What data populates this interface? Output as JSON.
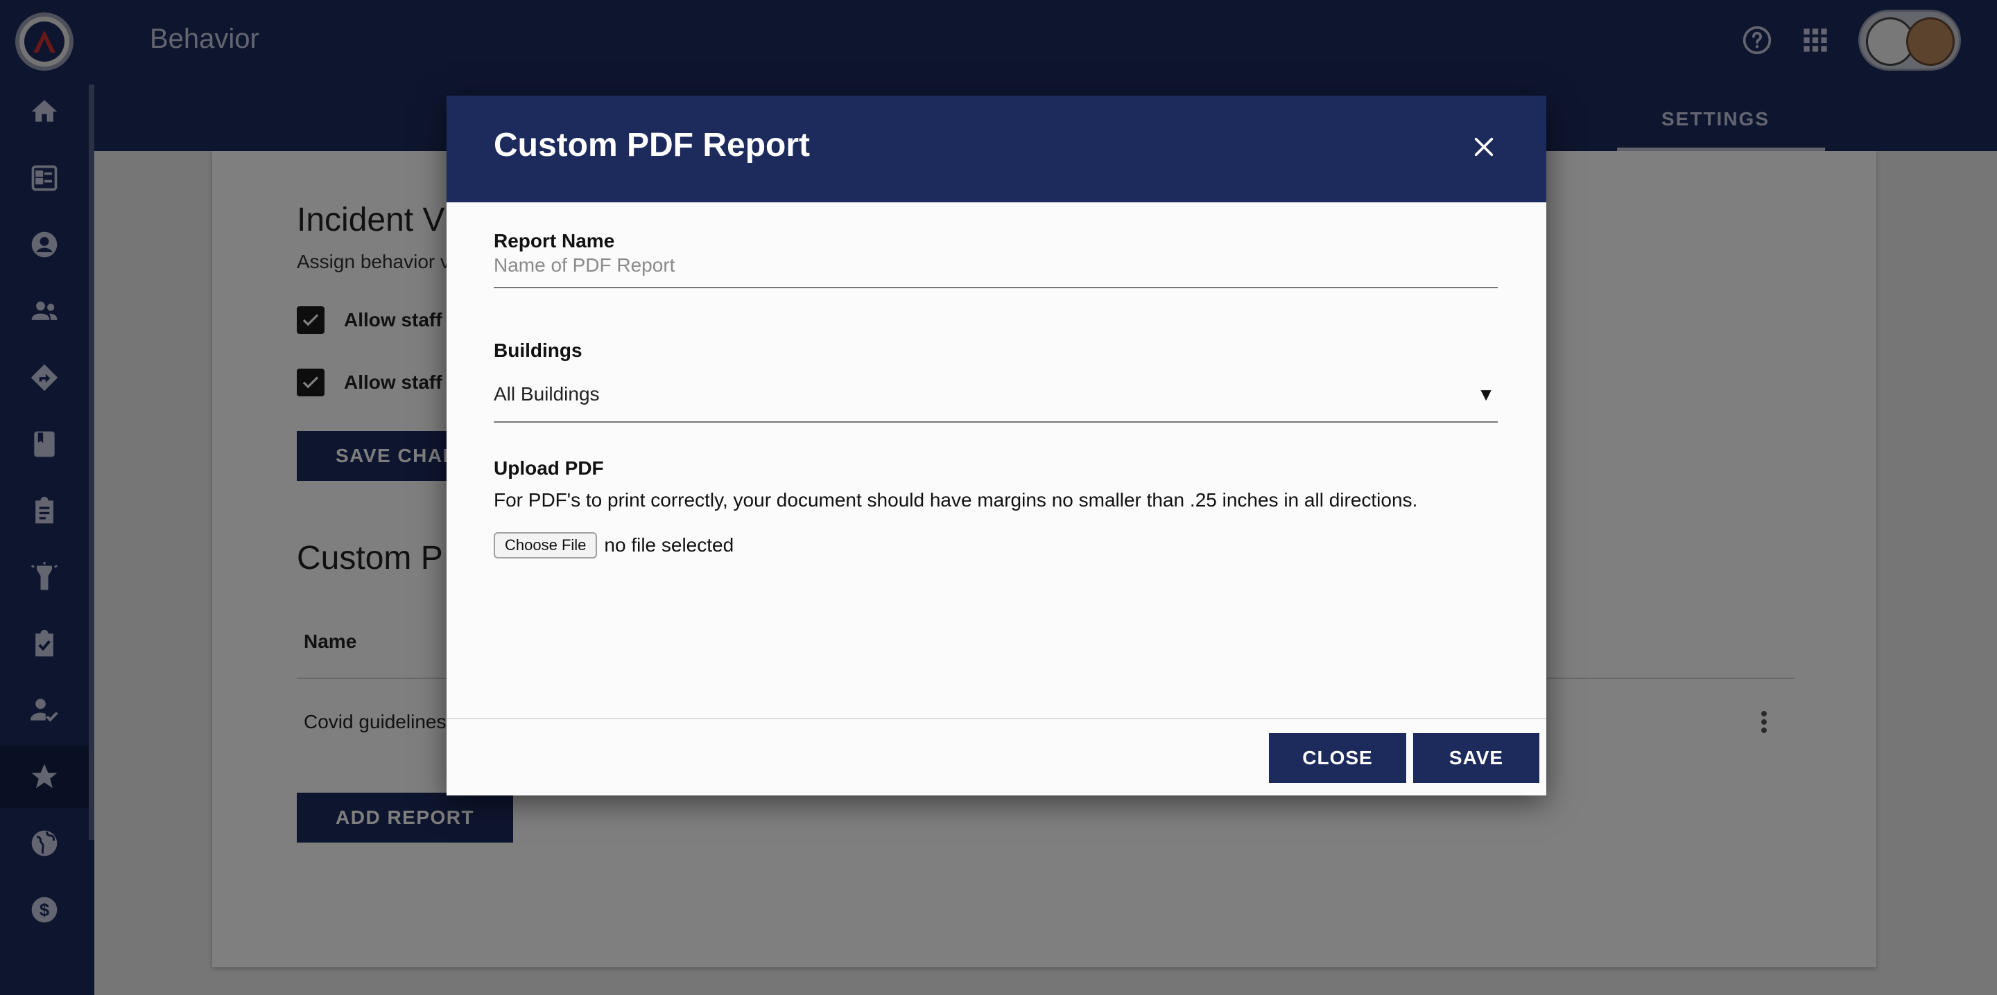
{
  "app": {
    "title": "Behavior"
  },
  "topbar": {
    "icons": [
      "help-icon",
      "apps-grid-icon"
    ],
    "colors": {
      "navy": "#1c2b5c",
      "accent_red": "#d32f2f"
    }
  },
  "tabs": {
    "settings": "SETTINGS"
  },
  "sidebar": {
    "items": [
      {
        "icon": "home-icon"
      },
      {
        "icon": "dashboard-icon"
      },
      {
        "icon": "account-circle-icon"
      },
      {
        "icon": "people-icon"
      },
      {
        "icon": "directions-icon"
      },
      {
        "icon": "book-icon"
      },
      {
        "icon": "clipboard-icon"
      },
      {
        "icon": "flashlight-icon"
      },
      {
        "icon": "clipboard-check-icon"
      },
      {
        "icon": "person-check-icon"
      },
      {
        "icon": "star-icon",
        "active": true
      },
      {
        "icon": "globe-icon"
      },
      {
        "icon": "dollar-icon"
      }
    ]
  },
  "page": {
    "incident_title": "Incident V",
    "incident_subtitle": "Assign behavior v",
    "checkbox_1_label": "Allow staff t",
    "checkbox_2_label": "Allow staff t",
    "save_changes_label": "SAVE CHAN",
    "custom_title": "Custom P",
    "table_header_name": "Name",
    "row_1_name": "Covid guidelines",
    "add_report_label": "ADD REPORT"
  },
  "modal": {
    "title": "Custom PDF Report",
    "report_name_label": "Report Name",
    "report_name_placeholder": "Name of PDF Report",
    "report_name_value": "",
    "buildings_label": "Buildings",
    "buildings_selected": "All Buildings",
    "upload_label": "Upload PDF",
    "upload_help": "For PDF's to print correctly, your document should have margins no smaller than .25 inches in all directions.",
    "choose_file_label": "Choose File",
    "file_status": "no file selected",
    "close_label": "CLOSE",
    "save_label": "SAVE"
  }
}
